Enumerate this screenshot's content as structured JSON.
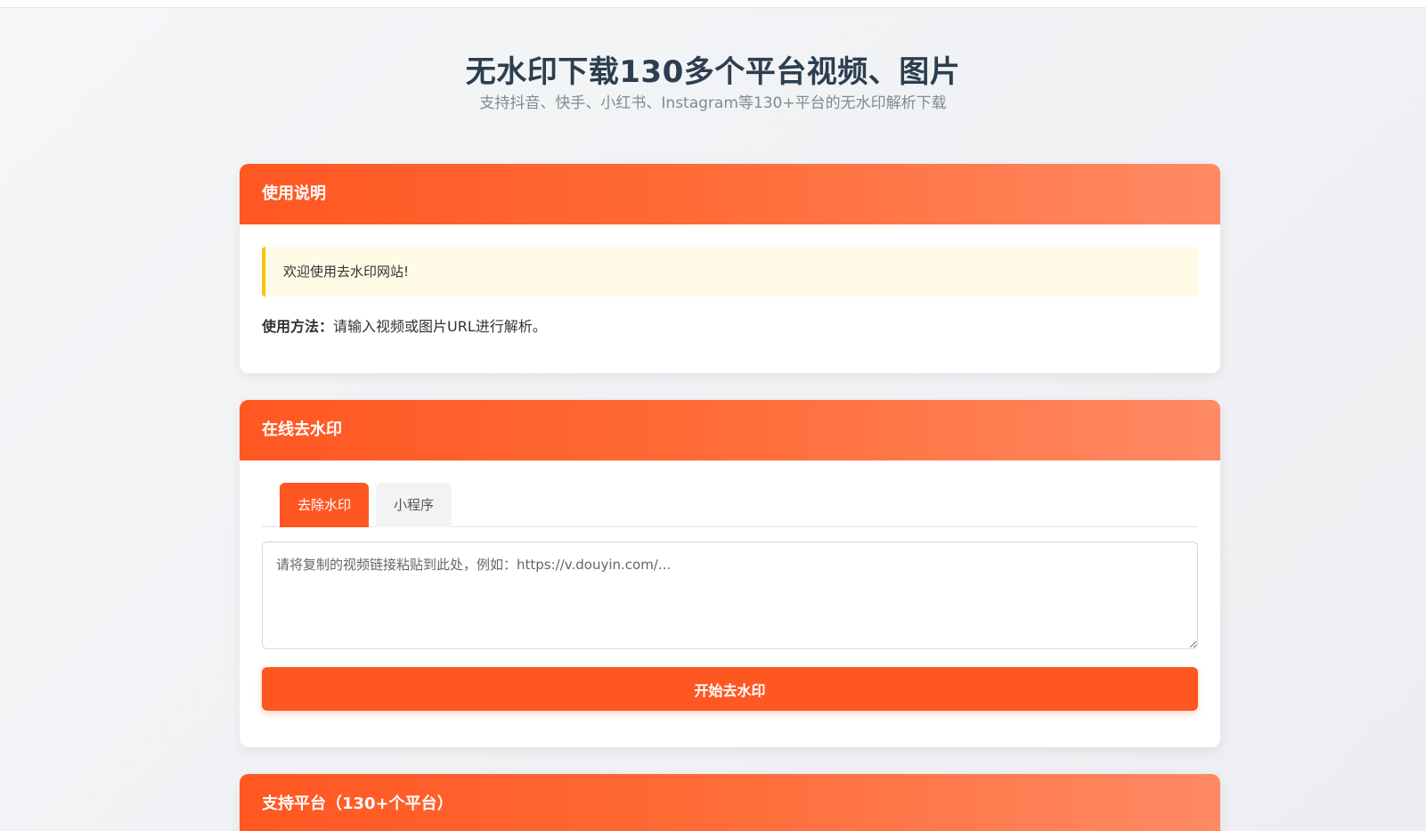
{
  "hero": {
    "title": "无水印下载130多个平台视频、图片",
    "subtitle": "支持抖音、快手、小红书、Instagram等130+平台的无水印解析下载"
  },
  "guide": {
    "header": "使用说明",
    "notice": "欢迎使用去水印网站!",
    "usage_label": "使用方法：",
    "usage_text": "请输入视频或图片URL进行解析。"
  },
  "tool": {
    "header": "在线去水印",
    "tabs": [
      {
        "label": "去除水印",
        "active": true
      },
      {
        "label": "小程序",
        "active": false
      }
    ],
    "input": {
      "placeholder": "请将复制的视频链接粘贴到此处，例如：https://v.douyin.com/...",
      "value": ""
    },
    "submit_label": "开始去水印"
  },
  "platforms": {
    "header": "支持平台（130+个平台）"
  },
  "colors": {
    "accent": "#ff5722",
    "accent_light": "#ff8a65",
    "notice_bg": "#fffbe6",
    "notice_border": "#ffc107",
    "title": "#2c3e50"
  }
}
